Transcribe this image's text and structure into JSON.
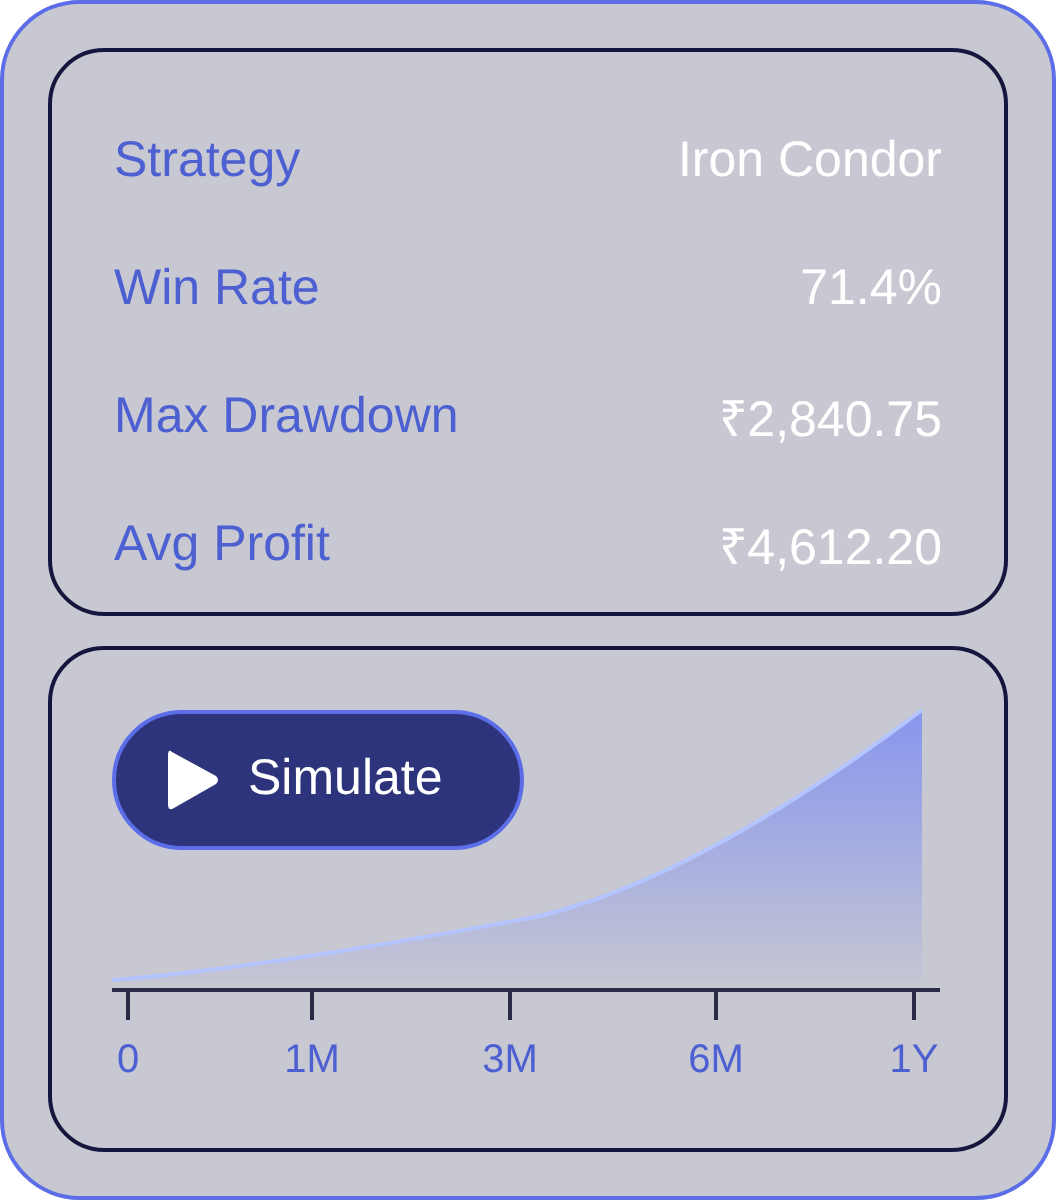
{
  "stats": [
    {
      "label": "Strategy",
      "value": "Iron Condor"
    },
    {
      "label": "Win Rate",
      "value": "71.4%"
    },
    {
      "label": "Max Drawdown",
      "value": "₹2,840.75"
    },
    {
      "label": "Avg Profit",
      "value": "₹4,612.20"
    }
  ],
  "simulate_button": {
    "label": "Simulate"
  },
  "x_axis_labels": [
    "0",
    "1M",
    "3M",
    "6M",
    "1Y"
  ]
}
